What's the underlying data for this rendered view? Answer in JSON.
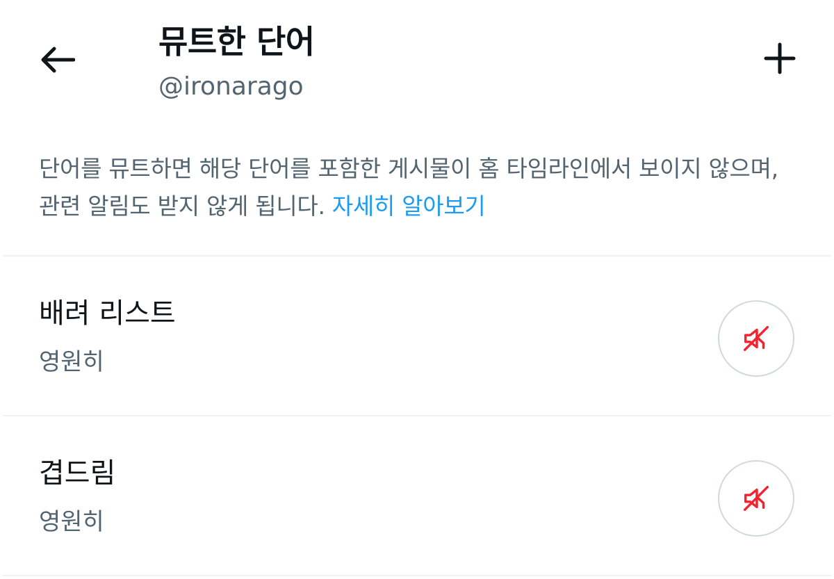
{
  "header": {
    "title": "뮤트한 단어",
    "handle": "@ironarago",
    "back_icon": "arrow-left-icon",
    "add_icon": "plus-icon"
  },
  "description": {
    "text": "단어를 뮤트하면 해당 단어를 포함한 게시물이 홈 타임라인에서 보이지 않으며, 관련 알림도 받지 않게 됩니다. ",
    "link_text": "자세히 알아보기"
  },
  "muted_words": [
    {
      "word": "배려 리스트",
      "duration": "영원히",
      "icon": "speaker-muted-icon"
    },
    {
      "word": "겹드림",
      "duration": "영원히",
      "icon": "speaker-muted-icon"
    }
  ],
  "colors": {
    "primary_text": "#0f1419",
    "secondary_text": "#536471",
    "link": "#1d9bf0",
    "mute_icon": "#f4212e",
    "divider": "#eff3f4",
    "button_border": "#cfd9de"
  }
}
